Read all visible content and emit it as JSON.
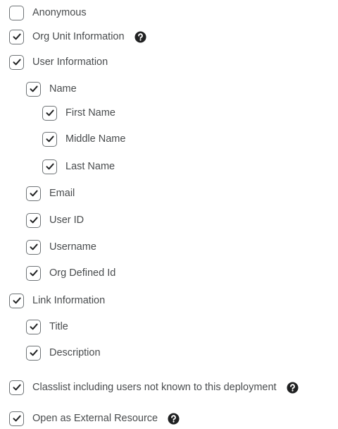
{
  "options": {
    "anonymous": {
      "label": "Anonymous",
      "checked": false,
      "icon": "checkbox-icon"
    },
    "org_unit_information": {
      "label": "Org Unit Information",
      "checked": true,
      "icon": "check-icon",
      "help_icon": "help-icon"
    },
    "user_information": {
      "label": "User Information",
      "checked": true,
      "icon": "check-icon"
    },
    "name": {
      "label": "Name",
      "checked": true,
      "icon": "check-icon"
    },
    "first_name": {
      "label": "First Name",
      "checked": true,
      "icon": "check-icon"
    },
    "middle_name": {
      "label": "Middle Name",
      "checked": true,
      "icon": "check-icon"
    },
    "last_name": {
      "label": "Last Name",
      "checked": true,
      "icon": "check-icon"
    },
    "email": {
      "label": "Email",
      "checked": true,
      "icon": "check-icon"
    },
    "user_id": {
      "label": "User ID",
      "checked": true,
      "icon": "check-icon"
    },
    "username": {
      "label": "Username",
      "checked": true,
      "icon": "check-icon"
    },
    "org_defined_id": {
      "label": "Org Defined Id",
      "checked": true,
      "icon": "check-icon"
    },
    "link_information": {
      "label": "Link Information",
      "checked": true,
      "icon": "check-icon"
    },
    "title": {
      "label": "Title",
      "checked": true,
      "icon": "check-icon"
    },
    "description": {
      "label": "Description",
      "checked": true,
      "icon": "check-icon"
    },
    "classlist_unknown_users": {
      "label": "Classlist including users not known to this deployment",
      "checked": true,
      "icon": "check-icon",
      "help_icon": "help-icon"
    },
    "open_as_external_resource": {
      "label": "Open as External Resource",
      "checked": true,
      "icon": "check-icon",
      "help_icon": "help-icon"
    }
  },
  "colors": {
    "text": "#494c4e",
    "checkbox_border": "#6e7376",
    "checkmark": "#202122",
    "help_icon": "#202122"
  }
}
